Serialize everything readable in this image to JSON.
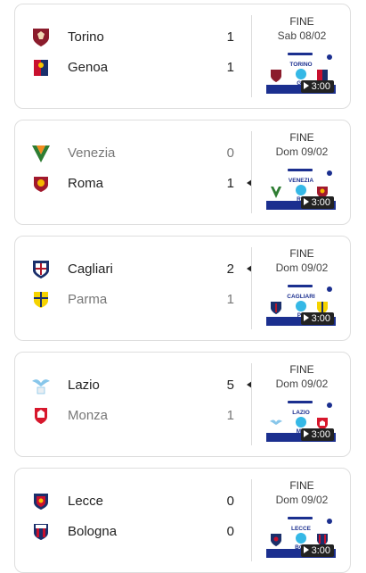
{
  "matches": [
    {
      "home": {
        "name": "Torino",
        "score": "1",
        "crest_color": "#8b1c2c"
      },
      "away": {
        "name": "Genoa",
        "score": "1",
        "crest_color": "#c8102e"
      },
      "winner": "none",
      "status": "FINE",
      "date": "Sab 08/02",
      "thumb": {
        "line1": "TORINO",
        "line2": "GE",
        "duration": "3:00"
      }
    },
    {
      "home": {
        "name": "Venezia",
        "score": "0",
        "crest_color": "#2e7d32"
      },
      "away": {
        "name": "Roma",
        "score": "1",
        "crest_color": "#a1192d"
      },
      "winner": "away",
      "status": "FINE",
      "date": "Dom 09/02",
      "thumb": {
        "line1": "VENEZIA",
        "line2": "RO",
        "duration": "3:00"
      }
    },
    {
      "home": {
        "name": "Cagliari",
        "score": "2",
        "crest_color": "#b1172b"
      },
      "away": {
        "name": "Parma",
        "score": "1",
        "crest_color": "#f5d300"
      },
      "winner": "home",
      "status": "FINE",
      "date": "Dom 09/02",
      "thumb": {
        "line1": "CAGLIARI",
        "line2": "PA",
        "duration": "3:00"
      }
    },
    {
      "home": {
        "name": "Lazio",
        "score": "5",
        "crest_color": "#87c6ea"
      },
      "away": {
        "name": "Monza",
        "score": "1",
        "crest_color": "#d7172c"
      },
      "winner": "home",
      "status": "FINE",
      "date": "Dom 09/02",
      "thumb": {
        "line1": "LAZIO",
        "line2": "MO",
        "duration": "3:00"
      }
    },
    {
      "home": {
        "name": "Lecce",
        "score": "0",
        "crest_color": "#c8102e"
      },
      "away": {
        "name": "Bologna",
        "score": "0",
        "crest_color": "#1a2f6b"
      },
      "winner": "none",
      "status": "FINE",
      "date": "Dom 09/02",
      "thumb": {
        "line1": "LECCE",
        "line2": "BOL",
        "duration": "3:00"
      }
    }
  ],
  "icons": {
    "crest": "team-crest-icon",
    "play": "play-icon",
    "win": "winner-arrow-icon"
  }
}
